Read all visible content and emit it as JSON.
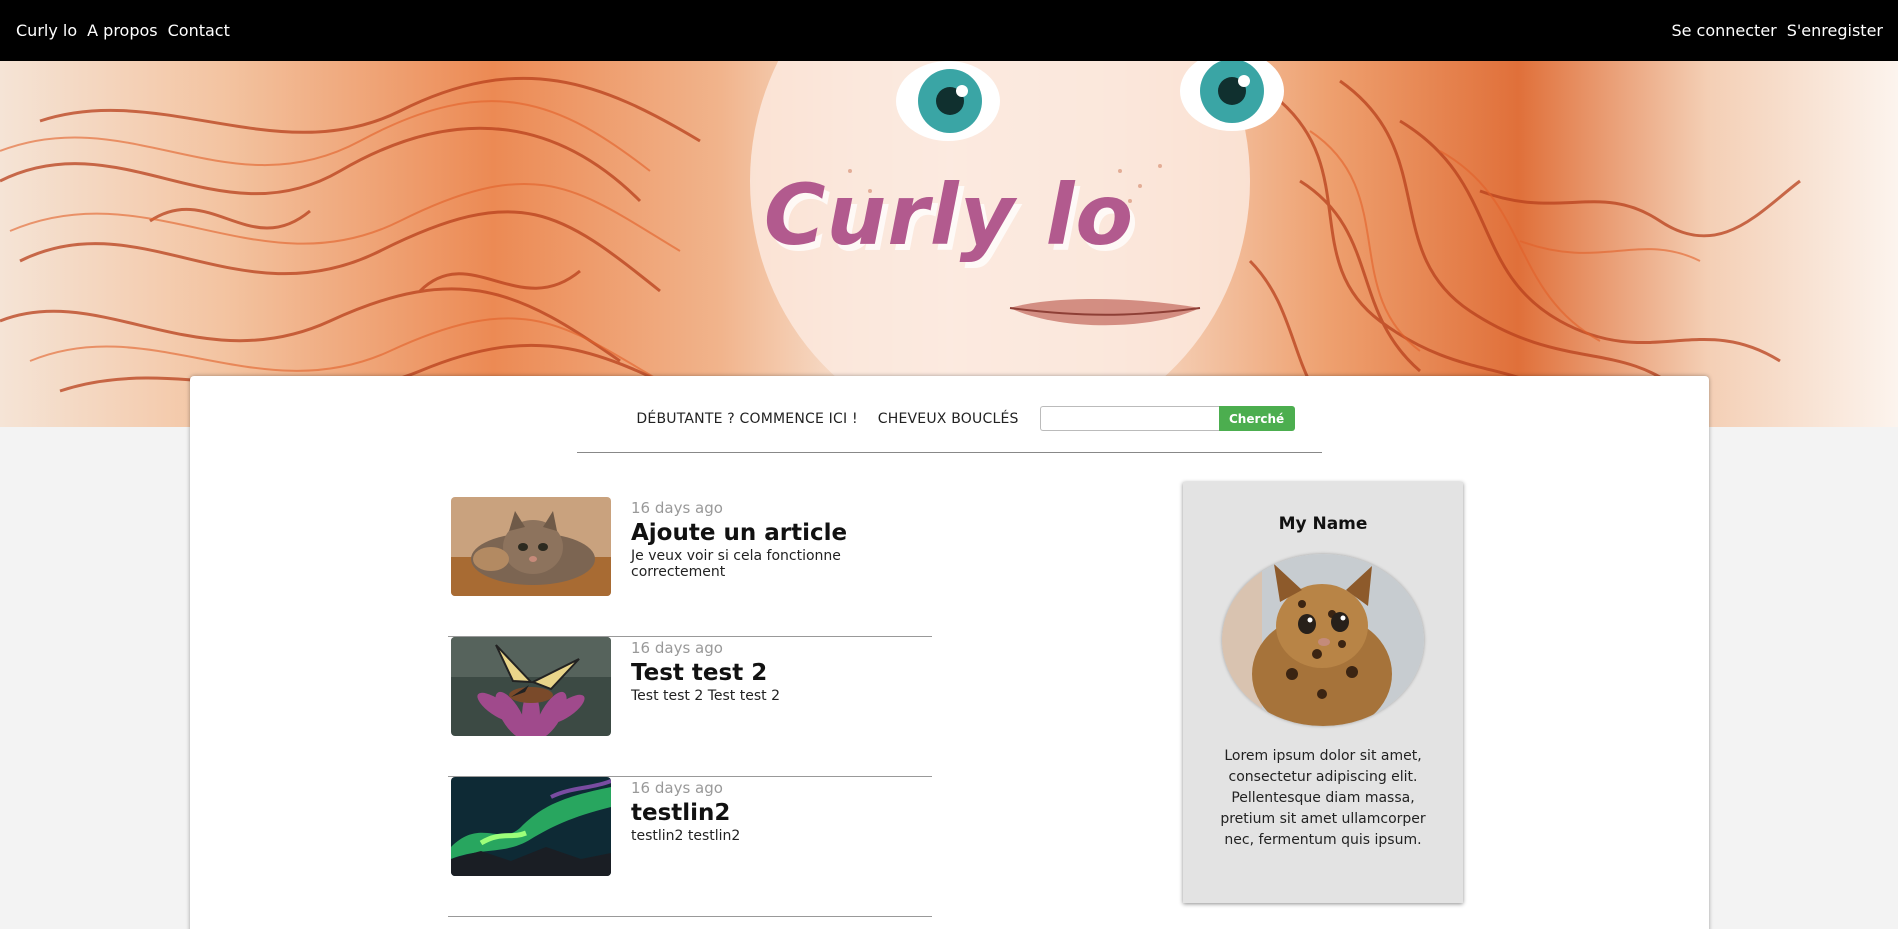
{
  "nav": {
    "left": [
      "Curly lo",
      "A propos",
      "Contact"
    ],
    "right": [
      "Se connecter",
      "S'enregister"
    ]
  },
  "hero": {
    "title": "Curly lo"
  },
  "subnav": {
    "links": [
      "DÉBUTANTE ? COMMENCE ICI !",
      "CHEVEUX BOUCLÉS"
    ],
    "search": {
      "value": "",
      "placeholder": "",
      "button_label": "Cherché"
    }
  },
  "articles": [
    {
      "date": "16 days ago",
      "title": "Ajoute un article",
      "excerpt": "Je veux voir si cela fonctionne correctement",
      "thumb": "cat-photo"
    },
    {
      "date": "16 days ago",
      "title": "Test test 2",
      "excerpt": "Test test 2 Test test 2",
      "thumb": "butterfly-photo"
    },
    {
      "date": "16 days ago",
      "title": "testlin2",
      "excerpt": "testlin2 testlin2",
      "thumb": "aurora-photo"
    }
  ],
  "profile": {
    "name": "My Name",
    "avatar": "kitten-photo",
    "bio": "Lorem ipsum dolor sit amet, consectetur adipiscing elit. Pellentesque diam massa, pretium sit amet ullamcorper nec, fermentum quis ipsum."
  },
  "colors": {
    "nav_bg": "#000000",
    "title": "#b25a8e",
    "search_button": "#4cae4f",
    "profile_bg": "#e3e3e3"
  }
}
